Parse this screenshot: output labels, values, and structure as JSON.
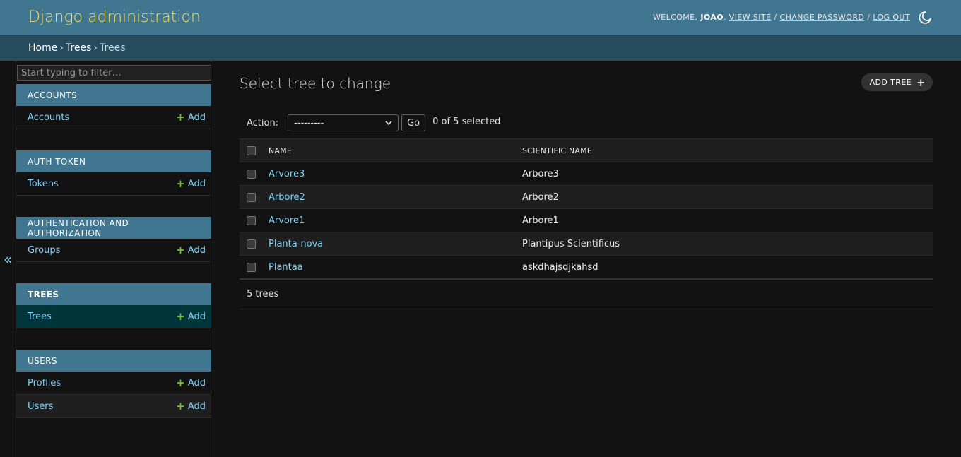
{
  "header": {
    "site_name": "Django administration",
    "welcome": "Welcome,",
    "username": "joao",
    "view_site": "View site",
    "change_password": "Change password",
    "log_out": "Log out",
    "theme_icon": "moon-icon"
  },
  "breadcrumbs": [
    "Home",
    "Trees",
    "Trees"
  ],
  "sidebar": {
    "filter_placeholder": "Start typing to filter…",
    "toggle_icon": "«",
    "add_label": "Add",
    "apps": [
      {
        "caption": "Accounts",
        "models": [
          "Accounts"
        ]
      },
      {
        "caption": "Auth Token",
        "models": [
          "Tokens"
        ]
      },
      {
        "caption": "Authentication and Authorization",
        "models": [
          "Groups"
        ]
      },
      {
        "caption": "Trees",
        "models": [
          "Trees"
        ],
        "current": true
      },
      {
        "caption": "Users",
        "models": [
          "Profiles",
          "Users"
        ]
      }
    ]
  },
  "content": {
    "title": "Select tree to change",
    "add_button": "Add tree",
    "action_label": "Action:",
    "action_selected": "---------",
    "go_label": "Go",
    "counter": "0 of 5 selected",
    "columns": [
      "Name",
      "Scientific name"
    ],
    "rows": [
      {
        "name": "Arvore3",
        "scientific_name": "Arbore3"
      },
      {
        "name": "Arbore2",
        "scientific_name": "Arbore2"
      },
      {
        "name": "Arvore1",
        "scientific_name": "Arbore1"
      },
      {
        "name": "Planta-nova",
        "scientific_name": "Plantipus Scientificus"
      },
      {
        "name": "Plantaa",
        "scientific_name": "askdhajsdjkahsd"
      }
    ],
    "paginator": "5 trees"
  },
  "colors": {
    "header_bg": "#417690",
    "breadcrumb_bg": "#264b5d",
    "site_name": "#f5dd5d",
    "link": "#81d4fa",
    "add_plus": "#70bf2b",
    "current_row": "#00363a"
  }
}
